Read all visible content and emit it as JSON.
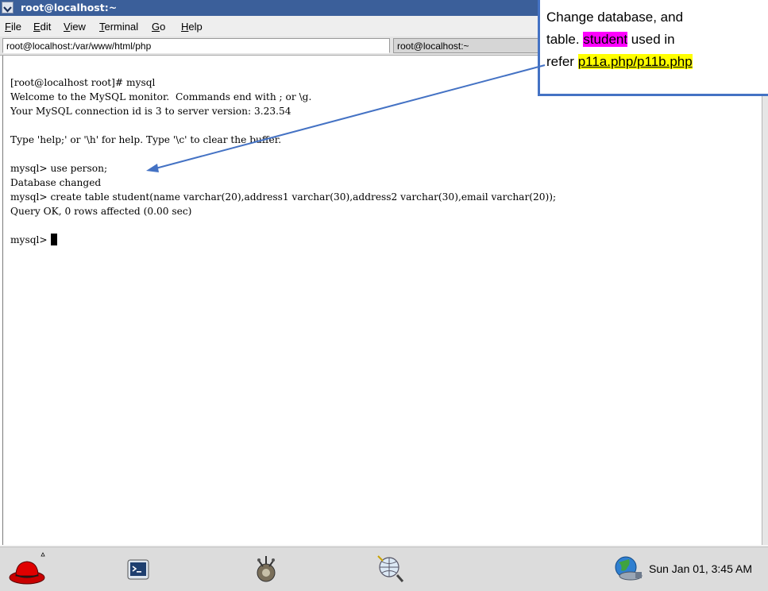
{
  "window": {
    "title": "root@localhost:~"
  },
  "menu": {
    "items": [
      {
        "mnemonic": "F",
        "rest": "ile"
      },
      {
        "mnemonic": "E",
        "rest": "dit"
      },
      {
        "mnemonic": "V",
        "rest": "iew"
      },
      {
        "mnemonic": "T",
        "rest": "erminal"
      },
      {
        "mnemonic": "G",
        "rest": "o"
      },
      {
        "mnemonic": "H",
        "rest": "elp"
      }
    ]
  },
  "tabs": [
    {
      "label": "root@localhost:/var/www/html/php",
      "active": true
    },
    {
      "label": "root@localhost:~",
      "active": false
    }
  ],
  "terminal": {
    "lines": [
      "[root@localhost root]# mysql",
      "Welcome to the MySQL monitor.  Commands end with ; or \\g.",
      "Your MySQL connection id is 3 to server version: 3.23.54",
      "",
      "Type 'help;' or '\\h' for help. Type '\\c' to clear the buffer.",
      "",
      "mysql> use person;",
      "Database changed",
      "mysql> create table student(name varchar(20),address1 varchar(30),address2 varchar(30),email varchar(20));",
      "Query OK, 0 rows affected (0.00 sec)",
      ""
    ],
    "prompt": "mysql>"
  },
  "taskbar": {
    "clock": "Sun Jan 01,  3:45 AM"
  },
  "callout": {
    "line1": "Change database, and",
    "line2_pre": "table. ",
    "line2_highlight": "student",
    "line2_post": " used in",
    "line3_pre": "refer ",
    "line3_highlight": "p11a.php/p11b.php",
    "highlight_colors": {
      "magenta": "#ff00ff",
      "yellow": "#ffff00"
    },
    "border_color": "#4472c4"
  }
}
